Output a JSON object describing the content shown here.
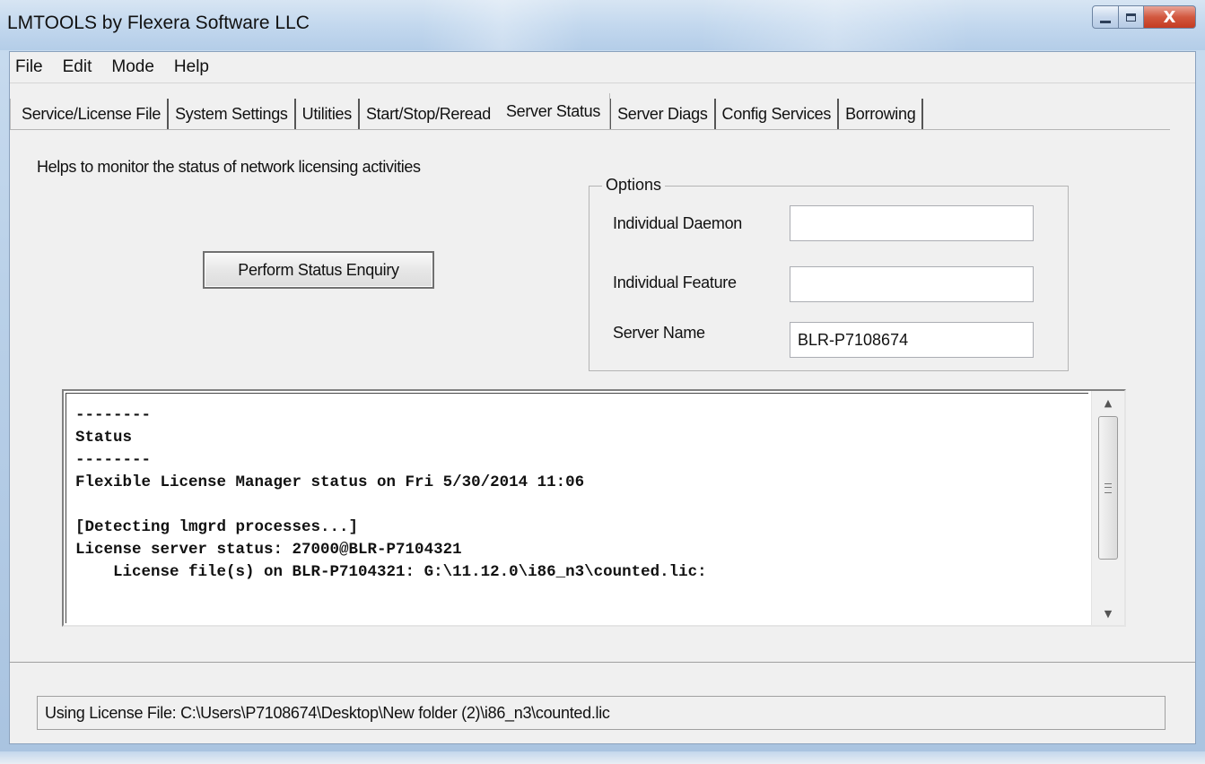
{
  "window": {
    "title": "LMTOOLS by Flexera Software LLC",
    "close_glyph": "X"
  },
  "menu": [
    "File",
    "Edit",
    "Mode",
    "Help"
  ],
  "tabs": [
    {
      "label": "Service/License File"
    },
    {
      "label": "System Settings"
    },
    {
      "label": "Utilities"
    },
    {
      "label": "Start/Stop/Reread"
    },
    {
      "label": "Server Status",
      "active": true
    },
    {
      "label": "Server Diags"
    },
    {
      "label": "Config Services"
    },
    {
      "label": "Borrowing"
    }
  ],
  "panel": {
    "description": "Helps to monitor the status of network licensing activities",
    "status_button": "Perform Status Enquiry",
    "options": {
      "legend": "Options",
      "daemon_label": "Individual Daemon",
      "daemon_value": "",
      "feature_label": "Individual Feature",
      "feature_value": "",
      "server_label": "Server Name",
      "server_value": "BLR-P7108674"
    }
  },
  "output": {
    "text": "--------\nStatus\n--------\nFlexible License Manager status on Fri 5/30/2014 11:06\n\n[Detecting lmgrd processes...]\nLicense server status: 27000@BLR-P7104321\n    License file(s) on BLR-P7104321: G:\\11.12.0\\i86_n3\\counted.lic:"
  },
  "statusbar": {
    "text": "Using License File:  C:\\Users\\P7108674\\Desktop\\New folder (2)\\i86_n3\\counted.lic"
  },
  "icons": {
    "minimize": "minimize-icon",
    "maximize": "maximize-icon",
    "close": "close-icon",
    "scroll_up": "scroll-up-icon",
    "scroll_down": "scroll-down-icon"
  },
  "colors": {
    "title_bar": "#c3d8ee",
    "close_button": "#c43c22",
    "dialog_bg": "#f0f0f0"
  }
}
